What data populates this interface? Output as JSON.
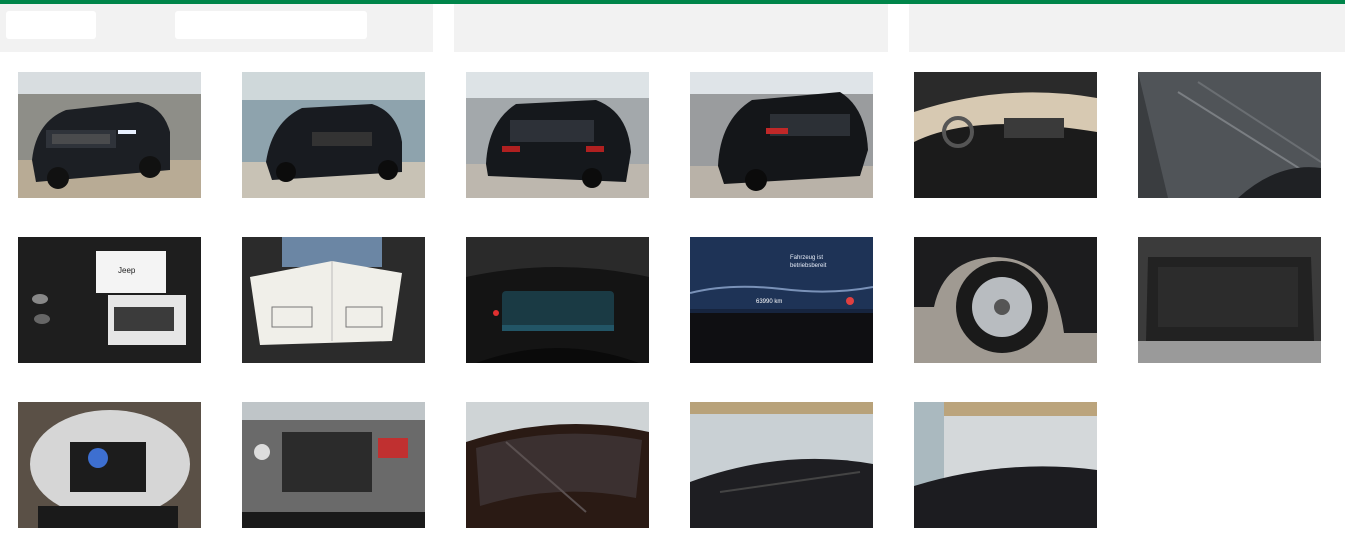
{
  "theme": {
    "accent": "#00854a",
    "panel_bg": "#f2f2f2"
  },
  "gallery": {
    "photos": [
      {
        "subject": "front-left exterior",
        "icon": "car-front-icon"
      },
      {
        "subject": "front exterior",
        "icon": "car-front-icon"
      },
      {
        "subject": "rear exterior",
        "icon": "car-rear-icon"
      },
      {
        "subject": "rear-left exterior",
        "icon": "car-rear-icon"
      },
      {
        "subject": "dashboard interior",
        "icon": "dashboard-icon"
      },
      {
        "subject": "door panel interior",
        "icon": "door-icon"
      },
      {
        "subject": "keys and manuals",
        "icon": "key-icon"
      },
      {
        "subject": "service booklet",
        "icon": "book-icon"
      },
      {
        "subject": "instrument cluster",
        "icon": "gauge-icon"
      },
      {
        "subject": "cluster warning display",
        "icon": "gauge-icon"
      },
      {
        "subject": "wheel and tyre",
        "icon": "wheel-icon"
      },
      {
        "subject": "boot space",
        "icon": "trunk-icon"
      },
      {
        "subject": "spare wheel well",
        "icon": "spare-wheel-icon"
      },
      {
        "subject": "engine bay",
        "icon": "engine-icon"
      },
      {
        "subject": "windscreen",
        "icon": "windscreen-icon"
      },
      {
        "subject": "roof view",
        "icon": "roof-icon"
      },
      {
        "subject": "roof view hall",
        "icon": "roof-icon"
      }
    ],
    "cluster_text": [
      "Fahrzeug ist",
      "betriebsbereit"
    ],
    "cluster_readout": "63990 km",
    "brand_text": "Jeep"
  }
}
